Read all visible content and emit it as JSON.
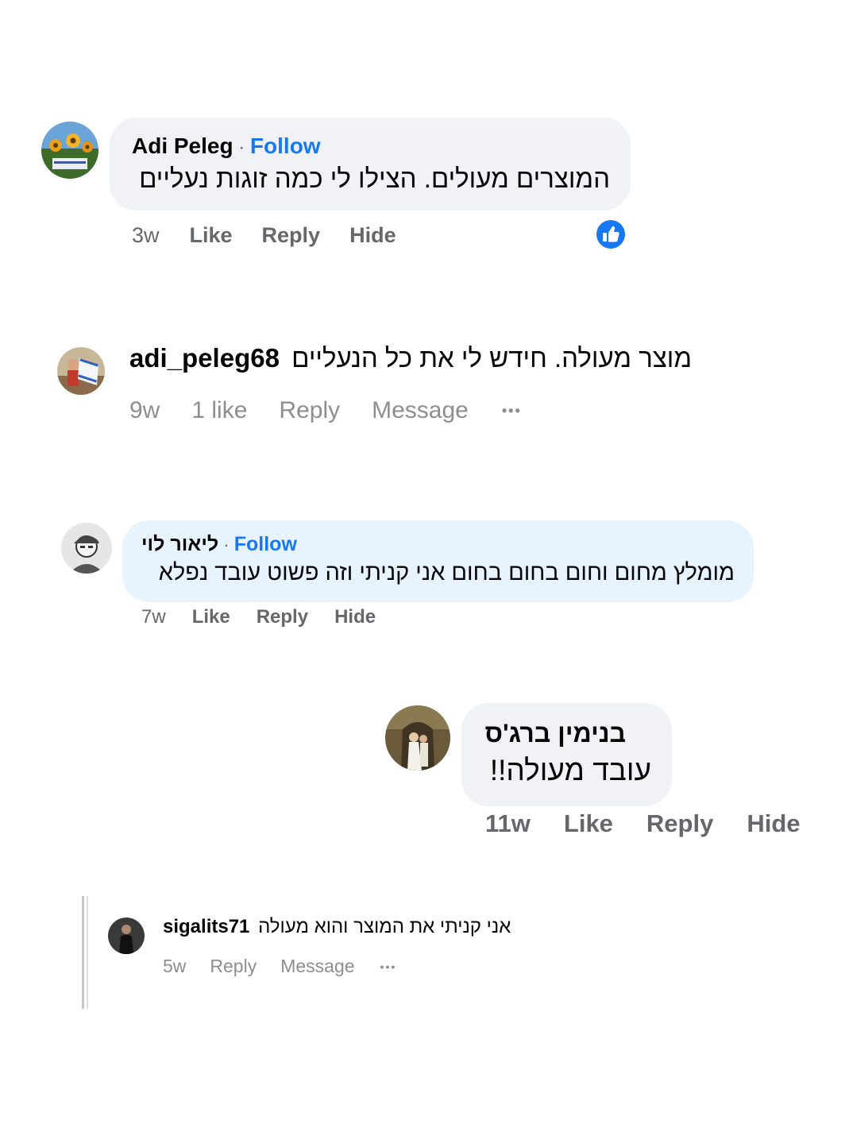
{
  "comments": [
    {
      "author": "Adi Peleg",
      "separator": " · ",
      "follow": "Follow",
      "text": "המוצרים מעולים. הצילו לי כמה זוגות נעליים",
      "time": "3w",
      "like": "Like",
      "reply": "Reply",
      "hide": "Hide",
      "reaction_icon": "thumbs-up-icon"
    },
    {
      "author": "adi_peleg68",
      "text": "מוצר מעולה. חידש לי את כל הנעליים",
      "time": "9w",
      "likes": "1 like",
      "reply": "Reply",
      "message": "Message",
      "more": "•••"
    },
    {
      "author": "ליאור לוי",
      "separator": " · ",
      "follow": "Follow",
      "text": "מומלץ מחום וחום בחום בחום אני קניתי וזה פשוט עובד נפלא",
      "time": "7w",
      "like": "Like",
      "reply": "Reply",
      "hide": "Hide"
    },
    {
      "author": "בנימין ברג'ס",
      "text": "עובד מעולה!!",
      "time": "11w",
      "like": "Like",
      "reply": "Reply",
      "hide": "Hide"
    },
    {
      "author": "sigalits71",
      "text": "אני קניתי את המוצר והוא מעולה",
      "time": "5w",
      "reply": "Reply",
      "message": "Message",
      "more": "•••"
    }
  ],
  "colors": {
    "bubble_gray": "#f0f2f5",
    "bubble_blue": "#e7f3ff",
    "link_blue": "#1877f2",
    "meta_gray": "#65676b",
    "ig_gray": "#8e8e8e"
  }
}
